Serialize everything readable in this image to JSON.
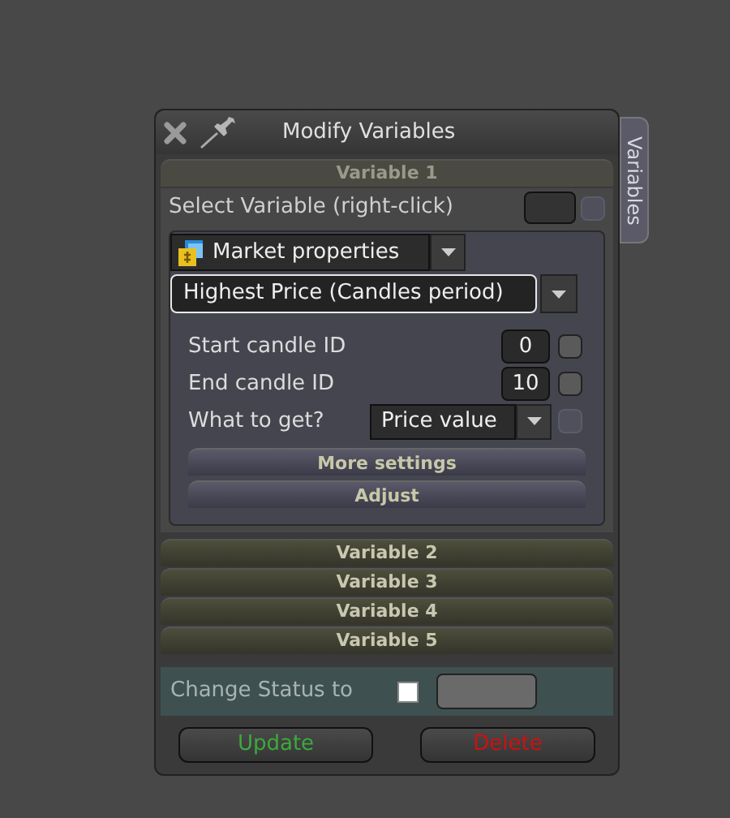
{
  "window": {
    "title": "Modify Variables"
  },
  "side_tab": {
    "label": "Variables"
  },
  "variables": [
    {
      "label": "Variable 1",
      "expanded": true
    },
    {
      "label": "Variable 2",
      "expanded": false
    },
    {
      "label": "Variable 3",
      "expanded": false
    },
    {
      "label": "Variable 4",
      "expanded": false
    },
    {
      "label": "Variable 5",
      "expanded": false
    }
  ],
  "variable_editor": {
    "select_label": "Select Variable (right-click)",
    "select_checkbox": {
      "checked": false,
      "disabled": true
    },
    "category": "Market properties",
    "function": "Highest Price (Candles period)",
    "params": [
      {
        "kind": "number",
        "label": "Start candle ID",
        "value": "0",
        "checked": false,
        "disabled": false
      },
      {
        "kind": "number",
        "label": "End candle ID",
        "value": "10",
        "checked": false,
        "disabled": false
      },
      {
        "kind": "dropdown",
        "label": "What to get?",
        "value": "Price value",
        "checked": false,
        "disabled": true
      }
    ],
    "buttons": [
      "More settings",
      "Adjust"
    ]
  },
  "status": {
    "label": "Change Status to",
    "checked": false
  },
  "actions": [
    {
      "kind": "update",
      "label": "Update"
    },
    {
      "kind": "delete",
      "label": "Delete"
    }
  ]
}
